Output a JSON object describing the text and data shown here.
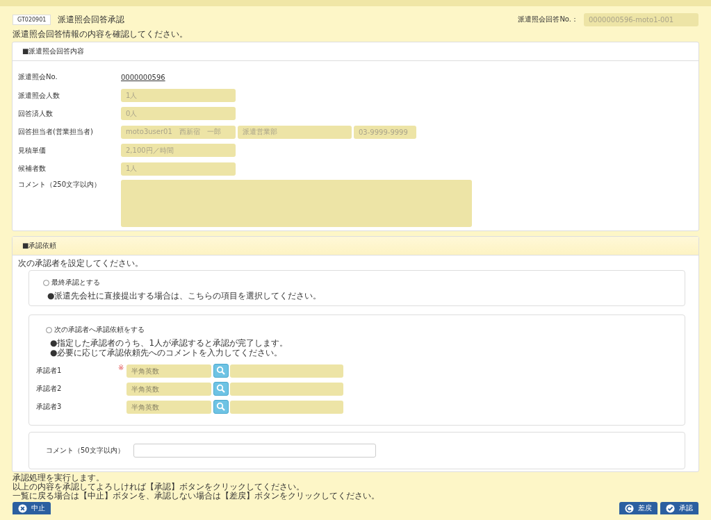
{
  "screen_id": "GT020901",
  "title": "派遣照会回答承認",
  "reply_no": {
    "label": "派遣照会回答No.：",
    "value": "0000000596-moto1-001"
  },
  "subtitle": "派遣照会回答情報の内容を確認してください。",
  "answer_section": {
    "heading": "■派遣照会回答内容",
    "fields": [
      {
        "label": "派遣照会No.",
        "kind": "link",
        "values": [
          "0000000596"
        ]
      },
      {
        "label": "派遣照会人数",
        "kind": "field",
        "values": [
          "1人"
        ]
      },
      {
        "label": "回答済人数",
        "kind": "field",
        "values": [
          "0人"
        ]
      },
      {
        "label": "回答担当者(営業担当者)",
        "kind": "field",
        "values": [
          "moto3user01　西新宿　一郎",
          "派遣営業部",
          "03-9999-9999"
        ]
      },
      {
        "label": "見積単価",
        "kind": "field",
        "values": [
          "2,100円／時間"
        ]
      },
      {
        "label": "候補者数",
        "kind": "field",
        "values": [
          "1人"
        ]
      },
      {
        "label": "コメント（250文字以内）",
        "kind": "textarea"
      }
    ]
  },
  "approval_section": {
    "heading": "■承認依頼",
    "instruction": "次の承認者を設定してください。",
    "options": [
      {
        "label": "最終承認とする",
        "selected": false,
        "notes": [
          "●派遣先会社に直接提出する場合は、こちらの項目を選択してください。"
        ]
      },
      {
        "label": "次の承認者へ承認依頼をする",
        "selected": false,
        "notes": [
          "●指定した承認者のうち、1人が承認すると承認が完了します。",
          "●必要に応じて承認依頼先へのコメントを入力してください。"
        ]
      }
    ],
    "approvers": [
      {
        "label": "承認者1",
        "required_mark": "※",
        "placeholder": "半角英数"
      },
      {
        "label": "承認者2",
        "placeholder": "半角英数"
      },
      {
        "label": "承認者3",
        "placeholder": "半角英数"
      }
    ],
    "comment_label": "コメント（50文字以内）"
  },
  "footer_text": [
    "承認処理を実行します。",
    "以上の内容を承認してよろしければ【承認】ボタンをクリックしてください。",
    "一覧に戻る場合は【中止】ボタンを、承認しない場合は【差戻】ボタンをクリックしてください。"
  ],
  "buttons": [
    {
      "label": "中止",
      "kind": "cancel"
    },
    {
      "label": "差戻",
      "kind": "return"
    },
    {
      "label": "承認",
      "kind": "approve"
    }
  ]
}
